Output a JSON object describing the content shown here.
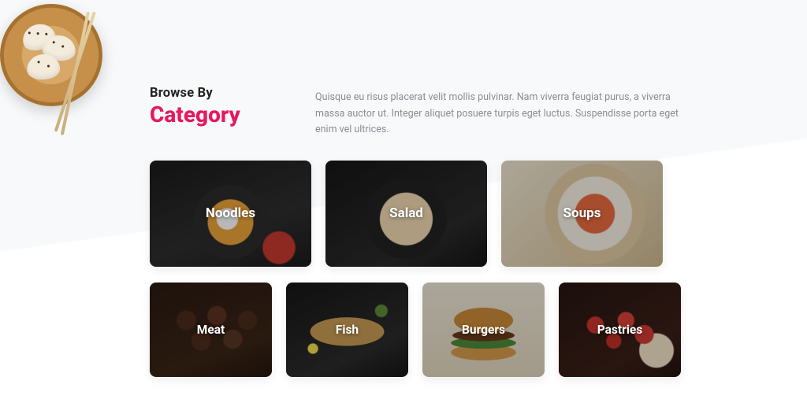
{
  "colors": {
    "accent": "#e6195e",
    "text_muted": "#8a8d94"
  },
  "hero_image_alt": "dumplings-plate",
  "header": {
    "pre_title": "Browse By",
    "title": "Category",
    "description": "Quisque eu risus placerat velit mollis pulvinar. Nam viverra feugiat purus, a viverra massa auctor ut. Integer aliquet posuere turpis eget luctus. Suspendisse porta eget enim vel ultrices."
  },
  "categories_row1": [
    {
      "name": "Noodles"
    },
    {
      "name": "Salad"
    },
    {
      "name": "Soups"
    }
  ],
  "categories_row2": [
    {
      "name": "Meat"
    },
    {
      "name": "Fish"
    },
    {
      "name": "Burgers"
    },
    {
      "name": "Pastries"
    }
  ]
}
